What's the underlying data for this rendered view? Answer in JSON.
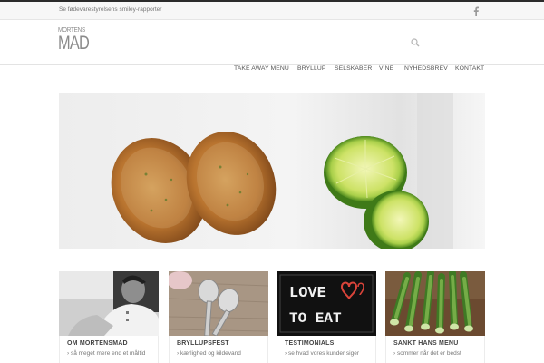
{
  "topbar": {
    "link": "Se fødevarestyrelsens smiley-rapporter",
    "social_icon": "facebook-icon"
  },
  "logo": {
    "line1": "MORTENS",
    "line2": "MAD"
  },
  "header": {
    "search_icon": "search-icon"
  },
  "nav": {
    "items": [
      {
        "label": "TAKE AWAY MENU"
      },
      {
        "label": "BRYLLUP"
      },
      {
        "label": "SELSKABER"
      },
      {
        "label": "VINE"
      },
      {
        "label": "NYHEDSBREV"
      },
      {
        "label": "KONTAKT"
      }
    ]
  },
  "cards": [
    {
      "title": "OM MORTENSMAD",
      "subtitle": "› så meget mere end et måltid"
    },
    {
      "title": "BRYLLUPSFEST",
      "subtitle": "› kærlighed og kildevand"
    },
    {
      "title": "TESTIMONIALS",
      "subtitle": "› se hvad vores kunder siger"
    },
    {
      "title": "SANKT HANS MENU",
      "subtitle": "› sommer når det er bedst"
    }
  ],
  "images": {
    "card3_text_line1": "LOVE",
    "card3_text_line2": "TO EAT"
  },
  "colors": {
    "topline": "#2b2b2b",
    "love_red": "#d9443a"
  }
}
